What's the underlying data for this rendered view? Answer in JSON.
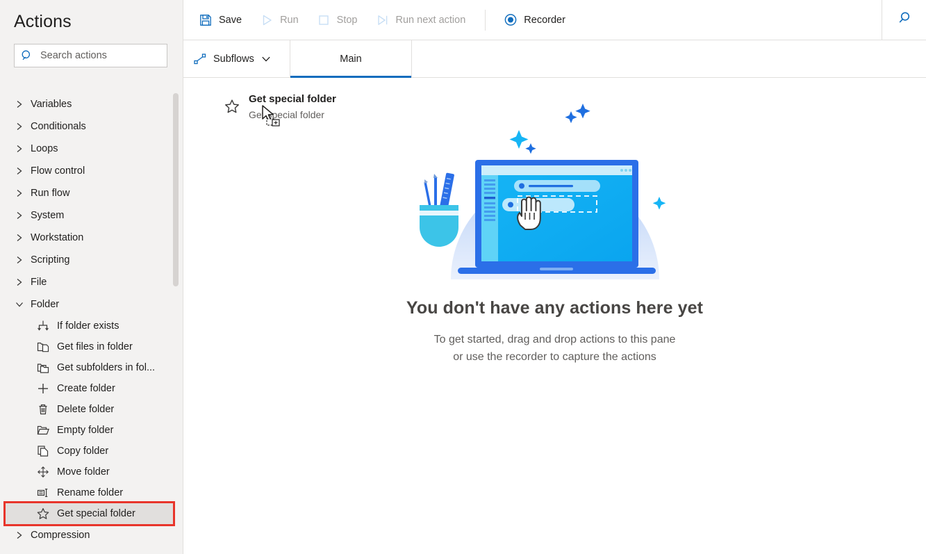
{
  "sidebar": {
    "title": "Actions",
    "search": {
      "placeholder": "Search actions",
      "icon": "search-icon"
    },
    "groups": [
      {
        "label": "Variables",
        "expanded": false
      },
      {
        "label": "Conditionals",
        "expanded": false
      },
      {
        "label": "Loops",
        "expanded": false
      },
      {
        "label": "Flow control",
        "expanded": false
      },
      {
        "label": "Run flow",
        "expanded": false
      },
      {
        "label": "System",
        "expanded": false
      },
      {
        "label": "Workstation",
        "expanded": false
      },
      {
        "label": "Scripting",
        "expanded": false
      },
      {
        "label": "File",
        "expanded": false
      },
      {
        "label": "Folder",
        "expanded": true
      },
      {
        "label": "Compression",
        "expanded": false
      }
    ],
    "folder_actions": [
      {
        "label": "If folder exists",
        "icon": "branch-arrows-icon",
        "selected": false
      },
      {
        "label": "Get files in folder",
        "icon": "folder-copy-icon",
        "selected": false
      },
      {
        "label": "Get subfolders in fol...",
        "icon": "folder-stack-icon",
        "selected": false
      },
      {
        "label": "Create folder",
        "icon": "plus-icon",
        "selected": false
      },
      {
        "label": "Delete folder",
        "icon": "trash-icon",
        "selected": false
      },
      {
        "label": "Empty folder",
        "icon": "open-folder-icon",
        "selected": false
      },
      {
        "label": "Copy folder",
        "icon": "copy-icon",
        "selected": false
      },
      {
        "label": "Move folder",
        "icon": "move-arrows-icon",
        "selected": false
      },
      {
        "label": "Rename folder",
        "icon": "rename-icon",
        "selected": false
      },
      {
        "label": "Get special folder",
        "icon": "star-icon",
        "selected": true
      }
    ],
    "highlight_color": "#e8352b",
    "selected_row_bg": "#e1dfdd"
  },
  "toolbar": {
    "buttons": [
      {
        "label": "Save",
        "icon": "save-icon",
        "enabled": true
      },
      {
        "label": "Run",
        "icon": "play-icon",
        "enabled": false
      },
      {
        "label": "Stop",
        "icon": "stop-icon",
        "enabled": false
      },
      {
        "label": "Run next action",
        "icon": "step-icon",
        "enabled": false
      },
      {
        "label": "Recorder",
        "icon": "record-icon",
        "enabled": true
      }
    ],
    "search_icon": "search-icon",
    "accent_color": "#0f6cbd"
  },
  "tabbar": {
    "subflows_label": "Subflows",
    "subflows_icon": "subflow-icon",
    "subflows_chevron": "chevron-down-icon",
    "tabs": [
      {
        "label": "Main",
        "active": true
      }
    ]
  },
  "canvas": {
    "drag_item": {
      "title": "Get special folder",
      "subtitle": "Get special folder",
      "icon": "star-icon",
      "cursor": "drag-copy-cursor"
    },
    "empty_state": {
      "title": "You don't have any actions here yet",
      "line1": "To get started, drag and drop actions to this pane",
      "line2": "or use the recorder to capture the actions",
      "illustration": "laptop-drag-drop-illustration"
    }
  }
}
